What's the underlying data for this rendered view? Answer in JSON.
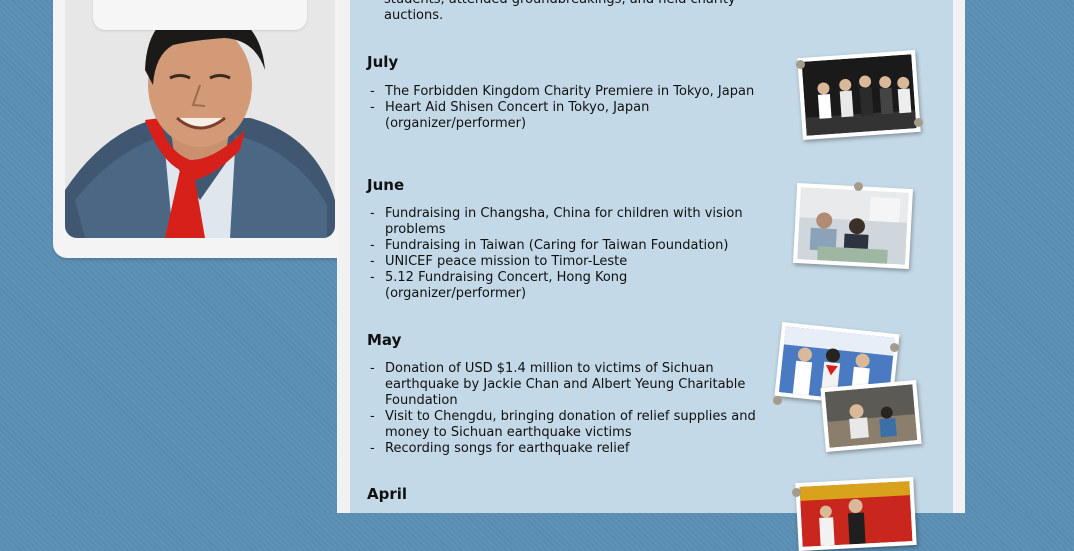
{
  "intro": {
    "line": "students, attended groundbreakings, and held charity",
    "line2": "auctions."
  },
  "months": [
    {
      "name": "July",
      "events": [
        "The Forbidden Kingdom Charity Premiere in Tokyo, Japan",
        "Heart Aid Shisen Concert in Tokyo, Japan (organizer/performer)"
      ]
    },
    {
      "name": "June",
      "events": [
        "Fundraising in Changsha, China for children with vision problems",
        "Fundraising in Taiwan (Caring for Taiwan Foundation)",
        "UNICEF peace mission to Timor-Leste",
        "5.12 Fundraising Concert, Hong Kong (organizer/performer)"
      ]
    },
    {
      "name": "May",
      "events": [
        "Donation of USD $1.4 million to victims of Sichuan earthquake by Jackie Chan and Albert Yeung Charitable Foundation",
        "Visit to Chengdu, bringing donation of relief supplies and money to Sichuan earthquake victims",
        "Recording songs for earthquake relief"
      ]
    },
    {
      "name": "April",
      "events": []
    }
  ],
  "colors": {
    "page_bg": "#5b8fb5",
    "content_bg": "#c4d9e7",
    "scarf": "#d8201a"
  }
}
